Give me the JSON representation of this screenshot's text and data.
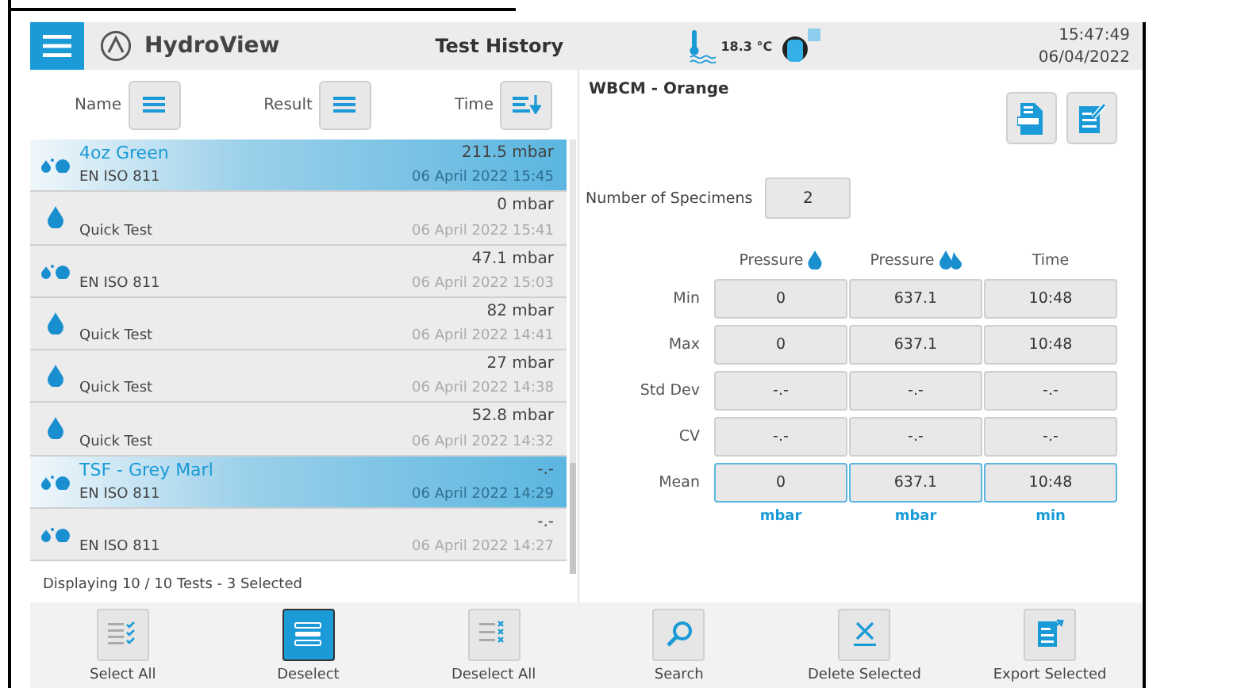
{
  "header": {
    "app_name": "HydroView",
    "title": "Test History",
    "temperature": "18.3 °C",
    "time": "15:47:49",
    "date": "06/04/2022"
  },
  "sort_controls": [
    {
      "label": "Name",
      "kind": "lines"
    },
    {
      "label": "Result",
      "kind": "lines"
    },
    {
      "label": "Time",
      "kind": "sort"
    }
  ],
  "tests": [
    {
      "kind": "double",
      "name": "4oz Green",
      "standard": "EN ISO 811",
      "result": "211.5 mbar",
      "date": "06 April 2022 15:45",
      "selected": true
    },
    {
      "kind": "single",
      "standard": "Quick Test",
      "result": "0 mbar",
      "date": "06 April 2022 15:41",
      "selected": false
    },
    {
      "kind": "double",
      "standard": "EN ISO 811",
      "result": "47.1 mbar",
      "date": "06 April 2022 15:03",
      "selected": false
    },
    {
      "kind": "single",
      "standard": "Quick Test",
      "result": "82 mbar",
      "date": "06 April 2022 14:41",
      "selected": false
    },
    {
      "kind": "single",
      "standard": "Quick Test",
      "result": "27 mbar",
      "date": "06 April 2022 14:38",
      "selected": false
    },
    {
      "kind": "single",
      "standard": "Quick Test",
      "result": "52.8 mbar",
      "date": "06 April 2022 14:32",
      "selected": false
    },
    {
      "kind": "double",
      "name": "TSF - Grey Marl",
      "standard": "EN ISO 811",
      "result": "-.-",
      "date": "06 April 2022 14:29",
      "selected": true
    },
    {
      "kind": "double",
      "standard": "EN ISO 811",
      "result": "-.-",
      "date": "06 April 2022 14:27",
      "selected": false
    }
  ],
  "status": "Displaying 10 / 10 Tests - 3 Selected",
  "detail": {
    "title": "WBCM - Orange",
    "specimens_label": "Number of Specimens",
    "specimens": "2",
    "columns": [
      {
        "label": "Pressure",
        "kind": "single"
      },
      {
        "label": "Pressure",
        "kind": "double"
      },
      {
        "label": "Time"
      }
    ],
    "rows": [
      {
        "label": "Min",
        "values": [
          "0",
          "637.1",
          "10:48"
        ],
        "highlighted": false
      },
      {
        "label": "Max",
        "values": [
          "0",
          "637.1",
          "10:48"
        ],
        "highlighted": false
      },
      {
        "label": "Std Dev",
        "values": [
          "-.-",
          "-.-",
          "-.-"
        ],
        "highlighted": false
      },
      {
        "label": "CV",
        "values": [
          "-.-",
          "-.-",
          "-.-"
        ],
        "highlighted": false
      },
      {
        "label": "Mean",
        "values": [
          "0",
          "637.1",
          "10:48"
        ],
        "highlighted": true
      }
    ],
    "units": [
      "mbar",
      "mbar",
      "min"
    ]
  },
  "toolbar": [
    {
      "label": "Select All",
      "kind": "select-all",
      "selected": false
    },
    {
      "label": "Deselect",
      "kind": "deselect",
      "selected": true
    },
    {
      "label": "Deselect All",
      "kind": "deselect-all",
      "selected": false
    },
    {
      "label": "Search",
      "kind": "search",
      "selected": false
    },
    {
      "label": "Delete Selected",
      "kind": "delete",
      "selected": false
    },
    {
      "label": "Export Selected",
      "kind": "export",
      "selected": false
    }
  ]
}
